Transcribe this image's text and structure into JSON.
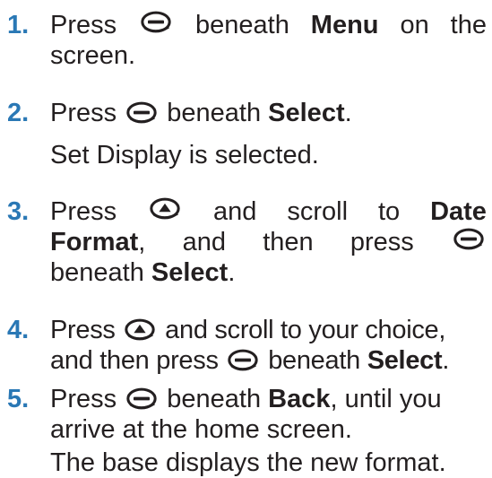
{
  "icons": {
    "select_key": "softkey-icon",
    "scroll_key": "scroll-up-key-icon"
  },
  "steps": [
    {
      "number": "1.",
      "press": "Press",
      "beneath": "beneath",
      "target": "Menu",
      "on": "on",
      "the": "the",
      "screen": "screen."
    },
    {
      "number": "2.",
      "press": "Press",
      "beneath": "beneath",
      "target": "Select",
      "period": ".",
      "note": "Set Display is selected."
    },
    {
      "number": "3.",
      "press": "Press",
      "and": "and",
      "scroll": "scroll",
      "to": "to",
      "target_a": "Date",
      "target_b": "Format",
      "comma": ",",
      "and2": "and",
      "then": "then",
      "press2": "press",
      "beneath": "beneath",
      "target2": "Select",
      "period": "."
    },
    {
      "number": "4.",
      "press": "Press",
      "rest1": "and scroll to your choice,",
      "rest2a": "and then press",
      "beneath": "beneath",
      "target": "Select",
      "period": "."
    },
    {
      "number": "5.",
      "press": "Press",
      "rest1a": "beneath",
      "target": "Back",
      "rest1b": ", until you",
      "rest2": "arrive at the home screen.",
      "note": "The base displays the new format."
    }
  ]
}
